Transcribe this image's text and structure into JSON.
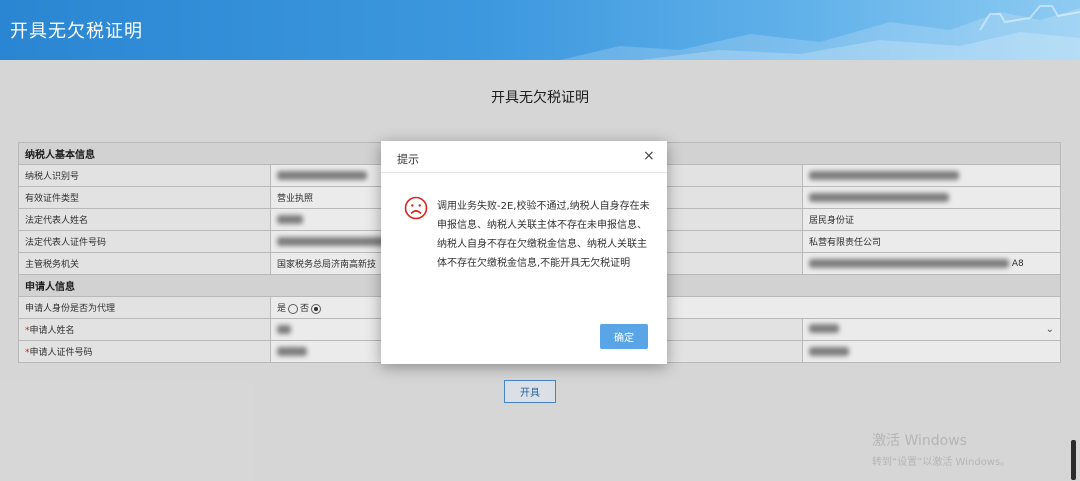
{
  "header": {
    "title": "开具无欠税证明"
  },
  "page": {
    "title": "开具无欠税证明"
  },
  "section_taxpayer": {
    "title": "纳税人基本信息"
  },
  "fields": {
    "taxpayer_id": "纳税人识别号",
    "cert_type": "有效证件类型",
    "cert_type_value": "营业执照",
    "legal_rep_name": "法定代表人姓名",
    "legal_rep_id_type_value": "居民身份证",
    "legal_rep_id_no": "法定代表人证件号码",
    "company_type_value": "私营有限责任公司",
    "tax_authority": "主管税务机关",
    "tax_authority_value": "国家税务总局济南高新技",
    "address_tail": "A8"
  },
  "section_applicant": {
    "title": "申请人信息"
  },
  "applicant": {
    "is_agent": "申请人身份是否为代理",
    "yes": "是",
    "no": "否",
    "required_mark": "*",
    "name": "申请人姓名",
    "id_no": "申请人证件号码"
  },
  "buttons": {
    "open": "开具"
  },
  "dialog": {
    "title": "提示",
    "close": "×",
    "message": "调用业务失败-2E,校验不通过,纳税人自身存在未申报信息、纳税人关联主体不存在未申报信息、纳税人自身不存在欠缴税金信息、纳税人关联主体不存在欠缴税金信息,不能开具无欠税证明",
    "ok": "确定"
  },
  "watermark": {
    "line1": "激活 Windows",
    "line2": "转到“设置”以激活 Windows。"
  },
  "colors": {
    "header": "#3d98de",
    "dialog_button": "#5aa5e5",
    "sad_icon": "#d9251d",
    "required": "#d9251d"
  }
}
